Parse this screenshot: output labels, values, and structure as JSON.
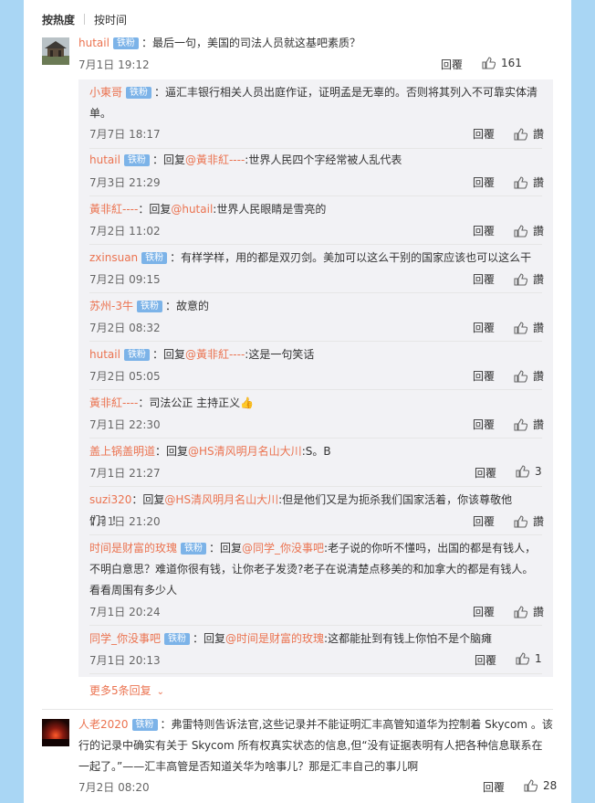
{
  "sort": {
    "hot": "按热度",
    "time": "按时间"
  },
  "badge": "铁粉",
  "reply_label": "回覆",
  "like_label": "讚",
  "comments": [
    {
      "user": "hutail",
      "text": "：最后一句，美国的司法人员就这基吧素质？",
      "time": "7月1日 19:12",
      "likes": "161"
    },
    {
      "user": "人老2020",
      "text": "：弗雷特则告诉法官,这些记录并不能证明汇丰高管知道华为控制着 Skycom 。该行的记录中确实有关于 Skycom 所有权真实状态的信息,但“没有证据表明有人把各种信息联系在一起了。”——汇丰高管是否知道关华为啥事儿？那是汇丰自己的事儿啊",
      "time": "7月2日 08:20",
      "likes": "28"
    }
  ],
  "replies": [
    {
      "user": "小東哥",
      "prefix": "",
      "mention": "",
      "text": "：逼汇丰银行相关人员出庭作证，证明孟是无辜的。否则将其列入不可靠实体清单。",
      "time": "7月7日 18:17",
      "likes": "讚"
    },
    {
      "user": "hutail",
      "prefix": "：回复",
      "mention": "@黃非紅----",
      "text": ":世界人民四个字经常被人乱代表",
      "time": "7月3日 21:29",
      "likes": "讚"
    },
    {
      "user": "黃非紅----",
      "prefix": "：回复",
      "mention": "@hutail",
      "text": ":世界人民眼睛是雪亮的",
      "time": "7月2日 11:02",
      "likes": "讚"
    },
    {
      "user": "zxinsuan",
      "prefix": "",
      "mention": "",
      "text": "：有样学样，用的都是双刃剑。美加可以这么干别的国家应该也可以这么干",
      "time": "7月2日 09:15",
      "likes": "讚"
    },
    {
      "user": "苏州-3牛",
      "prefix": "",
      "mention": "",
      "text": "：故意的",
      "time": "7月2日 08:32",
      "likes": "讚"
    },
    {
      "user": "hutail",
      "prefix": "：回复",
      "mention": "@黃非紅----",
      "text": ":这是一句笑话",
      "time": "7月2日 05:05",
      "likes": "讚"
    },
    {
      "user": "黃非紅----",
      "prefix": "",
      "mention": "",
      "text": "：司法公正 主持正义👍",
      "time": "7月1日 22:30",
      "likes": "讚"
    },
    {
      "user": "盖上锅盖明道",
      "prefix": "：回复",
      "mention": "@HS清风明月名山大川",
      "text": ":S。B",
      "time": "7月1日 21:27",
      "likes": "3"
    },
    {
      "user": "suzi320",
      "prefix": "：回复",
      "mention": "@HS清风明月名山大川",
      "text": ":但是他们又是为扼杀我们国家活着，你该尊敬他们？！",
      "time": "7月1日 21:20",
      "likes": "讚"
    },
    {
      "user": "时间是财富的玫瑰",
      "prefix": "：回复",
      "mention": "@同学_你没事吧",
      "text": ":老子说的你听不懂吗，出国的都是有钱人，不明白意思？难道你很有钱，让你老子发烫?老子在说清楚点移美的和加拿大的都是有钱人。看看周围有多少人",
      "time": "7月1日 20:24",
      "likes": "讚"
    },
    {
      "user": "同学_你没事吧",
      "prefix": "：回复",
      "mention": "@时间是财富的玫瑰",
      "text": ":这都能扯到有钱上你怕不是个脑瘫",
      "time": "7月1日 20:13",
      "likes": "1"
    }
  ],
  "more_replies": "更多5条回复"
}
